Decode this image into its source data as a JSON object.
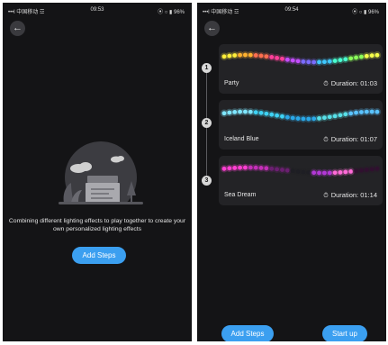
{
  "left": {
    "status": {
      "carrier": "•••l 中国移动 ☲",
      "time": "09:53",
      "battery": "⦿ ○ ▮ 96%"
    },
    "description": "Combining different lighting effects to play together to create your own personalized lighting effects",
    "add_steps": "Add Steps"
  },
  "right": {
    "status": {
      "carrier": "•••l 中国移动 ☲",
      "time": "09:54",
      "battery": "⦿ ○ ▮ 96%"
    },
    "steps": [
      {
        "number": "1",
        "name": "Party",
        "duration": "Duration: 01:03",
        "palette": [
          "#ffef3a",
          "#ffb12e",
          "#ff6f4f",
          "#ff3f9a",
          "#c44dff",
          "#7a6bff",
          "#3fc8ff",
          "#49ffd0",
          "#8aff5a",
          "#f6ff4a"
        ]
      },
      {
        "number": "2",
        "name": "Iceland Blue",
        "duration": "Duration: 01:07",
        "palette": [
          "#7fe6ff",
          "#3ed2f4",
          "#2aa8e8",
          "#57e0e8",
          "#5ac2ff"
        ]
      },
      {
        "number": "3",
        "name": "Sea Dream",
        "duration": "Duration: 01:14",
        "palette": [
          "#ff3fd2",
          "#c42fb8",
          "#6a1f70",
          "#1e1e24",
          "#b238d6",
          "#ff6bd8",
          "#30102f"
        ]
      }
    ],
    "add_steps": "Add Steps",
    "start_up": "Start up"
  },
  "icons": {
    "back": "arrow-left-icon",
    "duration": "stopwatch-icon"
  },
  "colors": {
    "accent": "#3b9ff0",
    "background": "#141416",
    "card": "#232326"
  }
}
